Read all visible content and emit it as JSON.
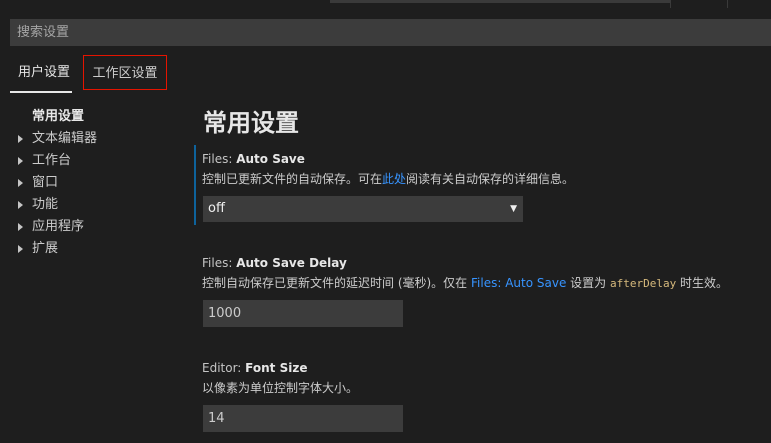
{
  "search": {
    "placeholder": "搜索设置"
  },
  "tabs": [
    {
      "label": "用户设置",
      "active": true
    },
    {
      "label": "工作区设置",
      "highlighted": true
    }
  ],
  "toc": {
    "title": "常用设置",
    "items": [
      "文本编辑器",
      "工作台",
      "窗口",
      "功能",
      "应用程序",
      "扩展"
    ]
  },
  "content": {
    "section_title": "常用设置",
    "settings": [
      {
        "category": "Files: ",
        "key": "Auto Save",
        "description_before": "控制已更新文件的自动保存。可在",
        "description_link": "此处",
        "description_after": "阅读有关自动保存的详细信息。",
        "value": "off",
        "dropdown_arrow": "▼"
      },
      {
        "category": "Files: ",
        "key": "Auto Save Delay",
        "description_before": "控制自动保存已更新文件的延迟时间 (毫秒)。仅在 ",
        "description_link": "Files: Auto Save",
        "description_middle": " 设置为 ",
        "description_code": "afterDelay",
        "description_after": " 时生效。",
        "value": "1000"
      },
      {
        "category": "Editor: ",
        "key": "Font Size",
        "description": "以像素为单位控制字体大小。",
        "value": "14"
      }
    ]
  },
  "colors": {
    "background": "#1e1e1e",
    "input_background": "#3c3c3c",
    "link": "#3794ff",
    "focus_border": "#0e639c",
    "tab_highlight_border": "#e51400",
    "code": "#d7ba7d"
  }
}
